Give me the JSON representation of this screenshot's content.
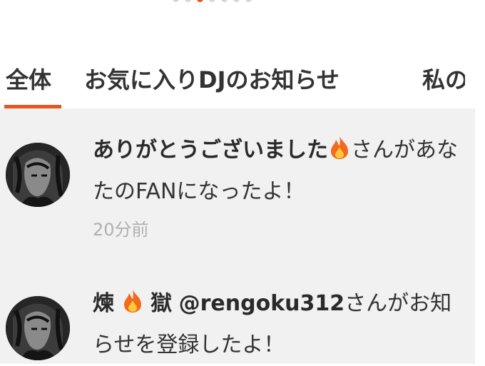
{
  "pager": {
    "count": 7,
    "active": 2
  },
  "tabs": [
    {
      "label": "全体"
    },
    {
      "label": "お気に入りDJのお知らせ"
    },
    {
      "label": "私の"
    }
  ],
  "notifications": [
    {
      "name": "ありがとうございました",
      "message_tail": "さんがあなたのFANになったよ！",
      "time": "20分前"
    },
    {
      "name_part1": "煉",
      "name_part2": "獄",
      "handle": "@rengoku312",
      "message_tail": "さんがお知らせを登録したよ！"
    }
  ],
  "icons": {
    "avatar": "avatar-image",
    "flame": "flame-icon"
  },
  "colors": {
    "accent": "#e9541d",
    "list_bg": "#f1f1f1",
    "time": "#b0b0b0"
  }
}
